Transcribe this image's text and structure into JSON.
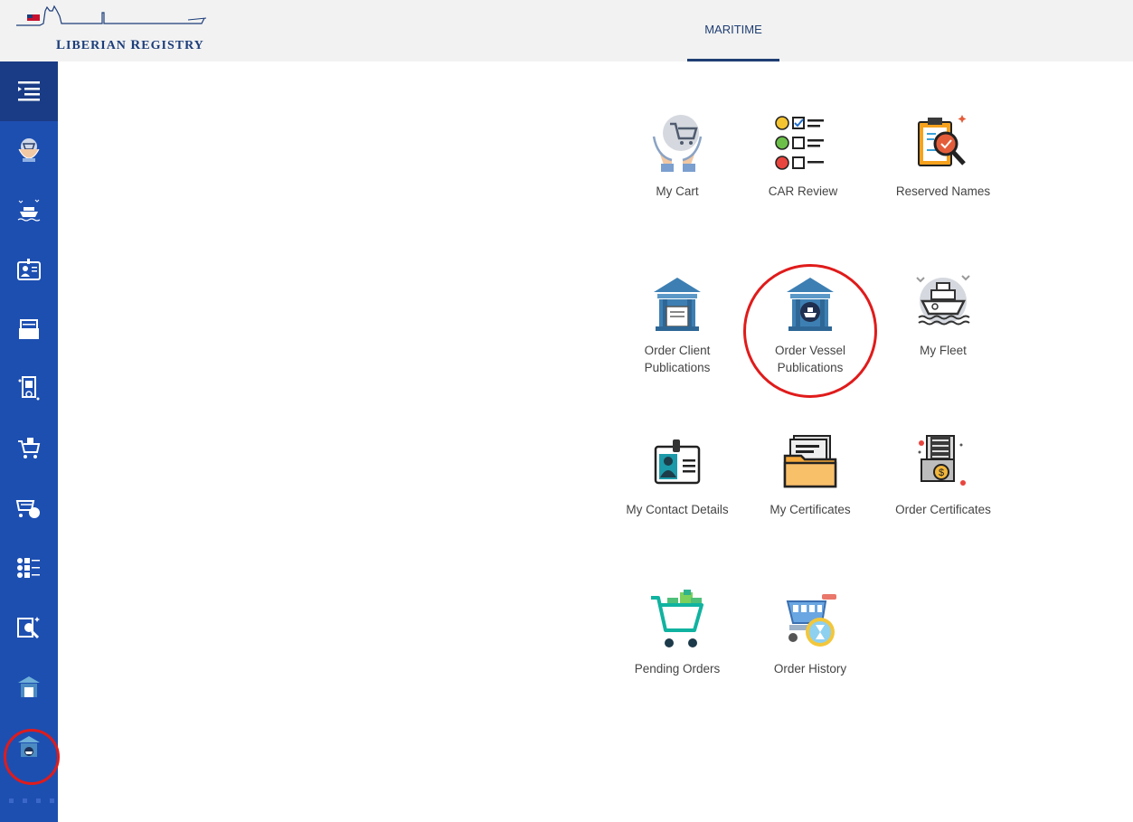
{
  "header": {
    "logo_text_big": "L",
    "logo_text_rest": "IBERIAN ",
    "logo_text_big2": "R",
    "logo_text_rest2": "EGISTRY",
    "active_tab": "MARITIME"
  },
  "sidebar": {
    "items": [
      {
        "icon": "menu-toggle-icon"
      },
      {
        "icon": "cart-hands-icon"
      },
      {
        "icon": "fleet-ship-icon"
      },
      {
        "icon": "contact-card-icon"
      },
      {
        "icon": "certificates-folder-icon"
      },
      {
        "icon": "order-certificates-icon"
      },
      {
        "icon": "pending-cart-icon"
      },
      {
        "icon": "order-history-icon"
      },
      {
        "icon": "car-review-icon"
      },
      {
        "icon": "reserved-names-icon"
      },
      {
        "icon": "client-publications-icon"
      },
      {
        "icon": "vessel-publications-icon"
      }
    ]
  },
  "tiles": {
    "my_cart": "My Cart",
    "car_review": "CAR Review",
    "reserved_names": "Reserved Names",
    "order_client_1": "Order Client",
    "order_client_2": "Publications",
    "order_vessel_1": "Order Vessel",
    "order_vessel_2": "Publications",
    "my_fleet": "My Fleet",
    "my_contact_details": "My Contact Details",
    "my_certificates": "My Certificates",
    "order_certificates": "Order Certificates",
    "pending_orders": "Pending Orders",
    "order_history": "Order History"
  },
  "colors": {
    "sidebar": "#1d4fb1",
    "sidebar_top": "#1a3c86",
    "header": "#f2f2f2",
    "accent_navy": "#1f3e73",
    "icon_steel": "#3d7fb3",
    "annotation_red": "#e01b1b"
  }
}
